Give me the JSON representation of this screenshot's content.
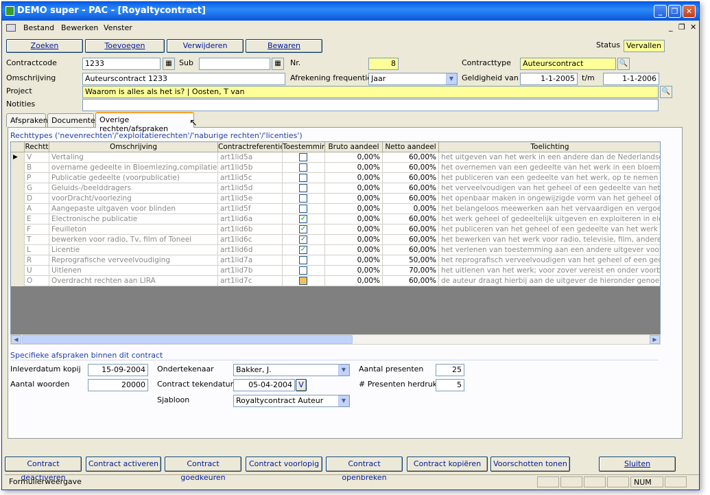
{
  "window": {
    "title": "DEMO super - PAC - [Royaltycontract]"
  },
  "menu": {
    "items": [
      "Bestand",
      "Bewerken",
      "Venster"
    ]
  },
  "toolbar": {
    "zoeken": "Zoeken",
    "toevoegen": "Toevoegen",
    "verwijderen": "Verwijderen",
    "bewaren": "Bewaren"
  },
  "status": {
    "label": "Status",
    "value": "Vervallen"
  },
  "form": {
    "contractcode_label": "Contractcode",
    "contractcode": "1233",
    "sub_label": "Sub",
    "sub": "",
    "nr_label": "Nr.",
    "nr": "8",
    "contracttype_label": "Contracttype",
    "contracttype": "Auteurscontract",
    "omschrijving_label": "Omschrijving",
    "omschrijving": "Auteurscontract 1233",
    "afrekening_label": "Afrekening frequentie",
    "afrekening": "Jaar",
    "geldigheid_label": "Geldigheid van",
    "geldigheid_van": "1-1-2005",
    "tm_label": "t/m",
    "geldigheid_tm": "1-1-2006",
    "project_label": "Project",
    "project": "Waarom is alles als het is? | Oosten, T van",
    "notities_label": "Notities",
    "notities": ""
  },
  "tabs": [
    "Afspraken",
    "Documenten",
    "Overige rechten/afspraken"
  ],
  "rechten": {
    "section_title": "Rechttypes ('nevenrechten'/'exploitatierechten'/'naburige rechten'/'licenties')",
    "columns": [
      "Rechtt",
      "Omschrijving",
      "Contractreferentie",
      "Toestemmin",
      "Bruto aandeel",
      "Netto aandeel",
      "Toelichting"
    ],
    "rows": [
      {
        "code": "V",
        "omschrijving": "Vertaling",
        "ref": "art1lid5a",
        "check": "off",
        "bruto": "0,00%",
        "netto": "60,00%",
        "toelichting": "het uitgeven van het werk in een andere dan de Nederlandse taal"
      },
      {
        "code": "B",
        "omschrijving": "overname gedeelte in Bloemlezing,compilatiewerk,",
        "ref": "art1lid5b",
        "check": "off",
        "bruto": "0,00%",
        "netto": "60,00%",
        "toelichting": "het overnemen van een gedeelte van het werk in een bloemlezing,"
      },
      {
        "code": "P",
        "omschrijving": "Publicatie gedeelte (voorpublicatie)",
        "ref": "art1lid5c",
        "check": "off",
        "bruto": "0,00%",
        "netto": "60,00%",
        "toelichting": "het publiceren van een gedeelte van het werk, op te nemen als vo"
      },
      {
        "code": "G",
        "omschrijving": "Geluids-/beelddragers",
        "ref": "art1lid5d",
        "check": "off",
        "bruto": "0,00%",
        "netto": "60,00%",
        "toelichting": "het verveelvoudigen van het geheel of een gedeelte van het werk"
      },
      {
        "code": "D",
        "omschrijving": "voorDracht/voorlezing",
        "ref": "art1lid5e",
        "check": "off",
        "bruto": "0,00%",
        "netto": "60,00%",
        "toelichting": "het openbaar maken in ongewijzigde vorm van het geheel of een g"
      },
      {
        "code": "A",
        "omschrijving": "Aangepaste uitgaven voor blinden",
        "ref": "art1lid5f",
        "check": "off",
        "bruto": "0,00%",
        "netto": "0,00%",
        "toelichting": "het belangeloos meewerken aan het vervaardigen en vergoedings"
      },
      {
        "code": "E",
        "omschrijving": "Electronische publicatie",
        "ref": "art1lid6a",
        "check": "on",
        "bruto": "0,00%",
        "netto": "60,00%",
        "toelichting": "het werk geheel of gedeeltelijk uitgeven en exploiteren in elektroni"
      },
      {
        "code": "F",
        "omschrijving": "Feuilleton",
        "ref": "art1lid6b",
        "check": "on",
        "bruto": "0,00%",
        "netto": "60,00%",
        "toelichting": "het publiceren van het geheel of een gedeelte van het werk als fe"
      },
      {
        "code": "T",
        "omschrijving": "bewerken voor radio, Tv, film of Toneel",
        "ref": "art1lid6c",
        "check": "on",
        "bruto": "0,00%",
        "netto": "60,00%",
        "toelichting": "het bewerken van het werk voor radio, televisie, film, andere audi"
      },
      {
        "code": "L",
        "omschrijving": "Licentie",
        "ref": "art1lid6d",
        "check": "on",
        "bruto": "0,00%",
        "netto": "60,00%",
        "toelichting": "het verlenen van toestemming aan een andere uitgever voor een"
      },
      {
        "code": "R",
        "omschrijving": "Reprografische verveelvoudiging",
        "ref": "art1lid7a",
        "check": "off",
        "bruto": "0,00%",
        "netto": "50,00%",
        "toelichting": "het reprografisch verveelvoudigen van het geheel of een gedeelte"
      },
      {
        "code": "U",
        "omschrijving": "Uitlenen",
        "ref": "art1lid7b",
        "check": "off",
        "bruto": "0,00%",
        "netto": "70,00%",
        "toelichting": "het uitlenen van het werk; voor zover vereist en onder voorbehou"
      },
      {
        "code": "O",
        "omschrijving": "Overdracht rechten aan LIRA",
        "ref": "art1lid7c",
        "check": "partial",
        "bruto": "0,00%",
        "netto": "60,00%",
        "toelichting": "de auteur draagt hierbij aan de uitgever de hieronder genoemde re"
      }
    ]
  },
  "specifiek": {
    "section_title": "Specifieke afspraken binnen dit contract",
    "inleverdatum_label": "Inleverdatum kopij",
    "inleverdatum": "15-09-2004",
    "aantal_woorden_label": "Aantal woorden",
    "aantal_woorden": "20000",
    "ondertekenaar_label": "Ondertekenaar",
    "ondertekenaar": "Bakker, J.",
    "tekendatum_label": "Contract tekendatum",
    "tekendatum": "05-04-2004",
    "tekendatum_btn": "V",
    "sjabloon_label": "Sjabloon",
    "sjabloon": "Royaltycontract Auteur",
    "presenten_label": "Aantal presenten",
    "presenten": "25",
    "presenten_herdruk_label": "# Presenten herdruk",
    "presenten_herdruk": "5"
  },
  "bottom_buttons": [
    "Contract deactiveren",
    "Contract activeren",
    "Contract goedkeuren",
    "Contract voorlopig",
    "Contract openbreken",
    "Contract kopiëren",
    "Voorschotten tonen",
    "Sluiten"
  ],
  "statusbar": {
    "text": "Formulierweergave",
    "num": "NUM"
  }
}
